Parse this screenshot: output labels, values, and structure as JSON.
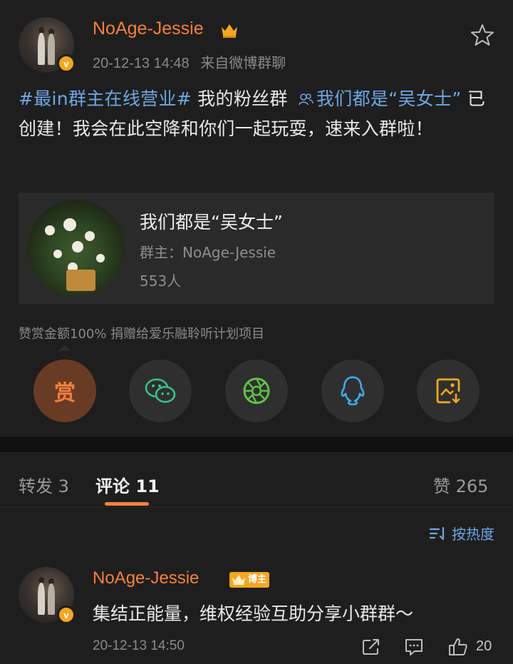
{
  "post": {
    "user_name": "NoAge-Jessie",
    "time": "20-12-13 14:48",
    "source": "来自微博群聊",
    "text": {
      "hashtag": "#最in群主在线营业#",
      "part1": " 我的粉丝群 ",
      "group_link": "我们都是“吴女士”",
      "part2": " 已创建！我会在此空降和你们一起玩耍，速来入群啦！"
    },
    "card": {
      "title": "我们都是“吴女士”",
      "owner": "群主：NoAge-Jessie",
      "members": "553人"
    },
    "donate_note": "赞赏金额100% 捐赠给爱乐融聆听计划项目",
    "reward_label": "赏",
    "share_icons": [
      "reward-icon",
      "wechat-icon",
      "moments-icon",
      "qq-icon",
      "save-image-icon"
    ]
  },
  "tabs": {
    "repost": "转发 3",
    "comment": "评论 11",
    "like": "赞 265"
  },
  "comments": {
    "sort_label": "按热度",
    "items": [
      {
        "user_name": "NoAge-Jessie",
        "badge": "博主",
        "text": "集结正能量，维权经验互助分享小群群～",
        "time": "20-12-13 14:50",
        "likes": "20"
      }
    ]
  },
  "colors": {
    "accent": "#f5803e",
    "link": "#6ea7e6",
    "badge": "#f5a623",
    "background": "#1e1e1e"
  }
}
